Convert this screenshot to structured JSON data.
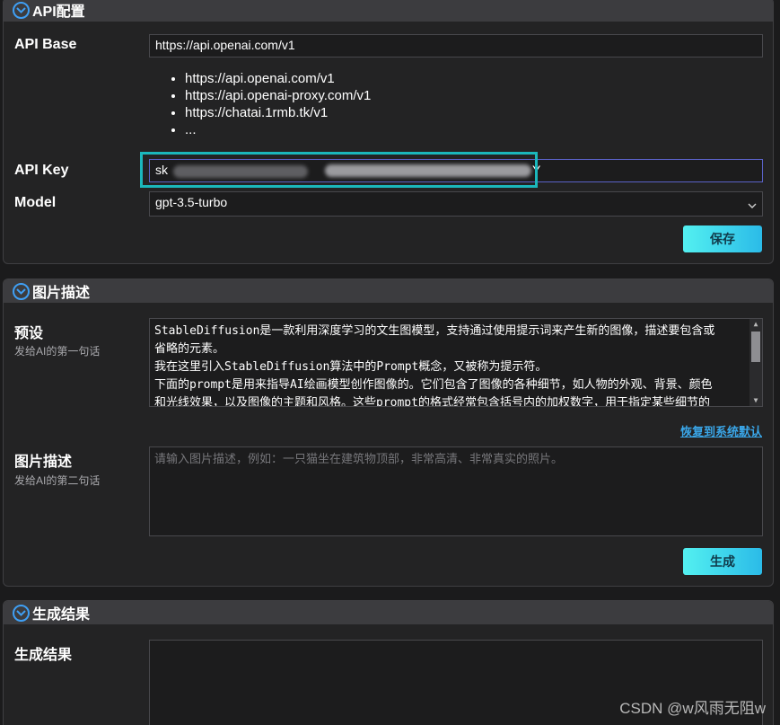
{
  "api_config": {
    "title": "API配置",
    "api_base_label": "API Base",
    "api_base_value": "https://api.openai.com/v1",
    "base_options": [
      "https://api.openai.com/v1",
      "https://api.openai-proxy.com/v1",
      "https://chatai.1rmb.tk/v1",
      "..."
    ],
    "api_key_label": "API Key",
    "api_key_prefix": "sk",
    "api_key_suffix": "Y",
    "model_label": "Model",
    "model_value": "gpt-3.5-turbo",
    "save_label": "保存"
  },
  "image_desc": {
    "title": "图片描述",
    "preset_label": "预设",
    "preset_sub": "发给AI的第一句话",
    "preset_lines": [
      "StableDiffusion是一款利用深度学习的文生图模型，支持通过使用提示词来产生新的图像，描述要包含或",
      "省略的元素。",
      "我在这里引入StableDiffusion算法中的Prompt概念，又被称为提示符。",
      "下面的prompt是用来指导AI绘画模型创作图像的。它们包含了图像的各种细节，如人物的外观、背景、颜色",
      "和光线效果，以及图像的主题和风格。这些prompt的格式经常包含括号内的加权数字，用于指定某些细节的"
    ],
    "reset_label": "恢复到系统默认",
    "desc_label": "图片描述",
    "desc_sub": "发给AI的第二句话",
    "desc_placeholder": "请输入图片描述，例如：一只猫坐在建筑物顶部，非常高清、非常真实的照片。",
    "generate_label": "生成"
  },
  "result": {
    "title": "生成结果",
    "label": "生成结果"
  },
  "watermark": "CSDN @w风雨无阻w",
  "colors": {
    "accent": "#3f9ff4",
    "button_gradient_start": "#53f0f0",
    "button_gradient_end": "#2bbbe8",
    "highlight_box": "#1bb7bc",
    "link": "#3aa6e8"
  },
  "icons": [
    "chevron-down-icon",
    "select-arrow-icon"
  ]
}
